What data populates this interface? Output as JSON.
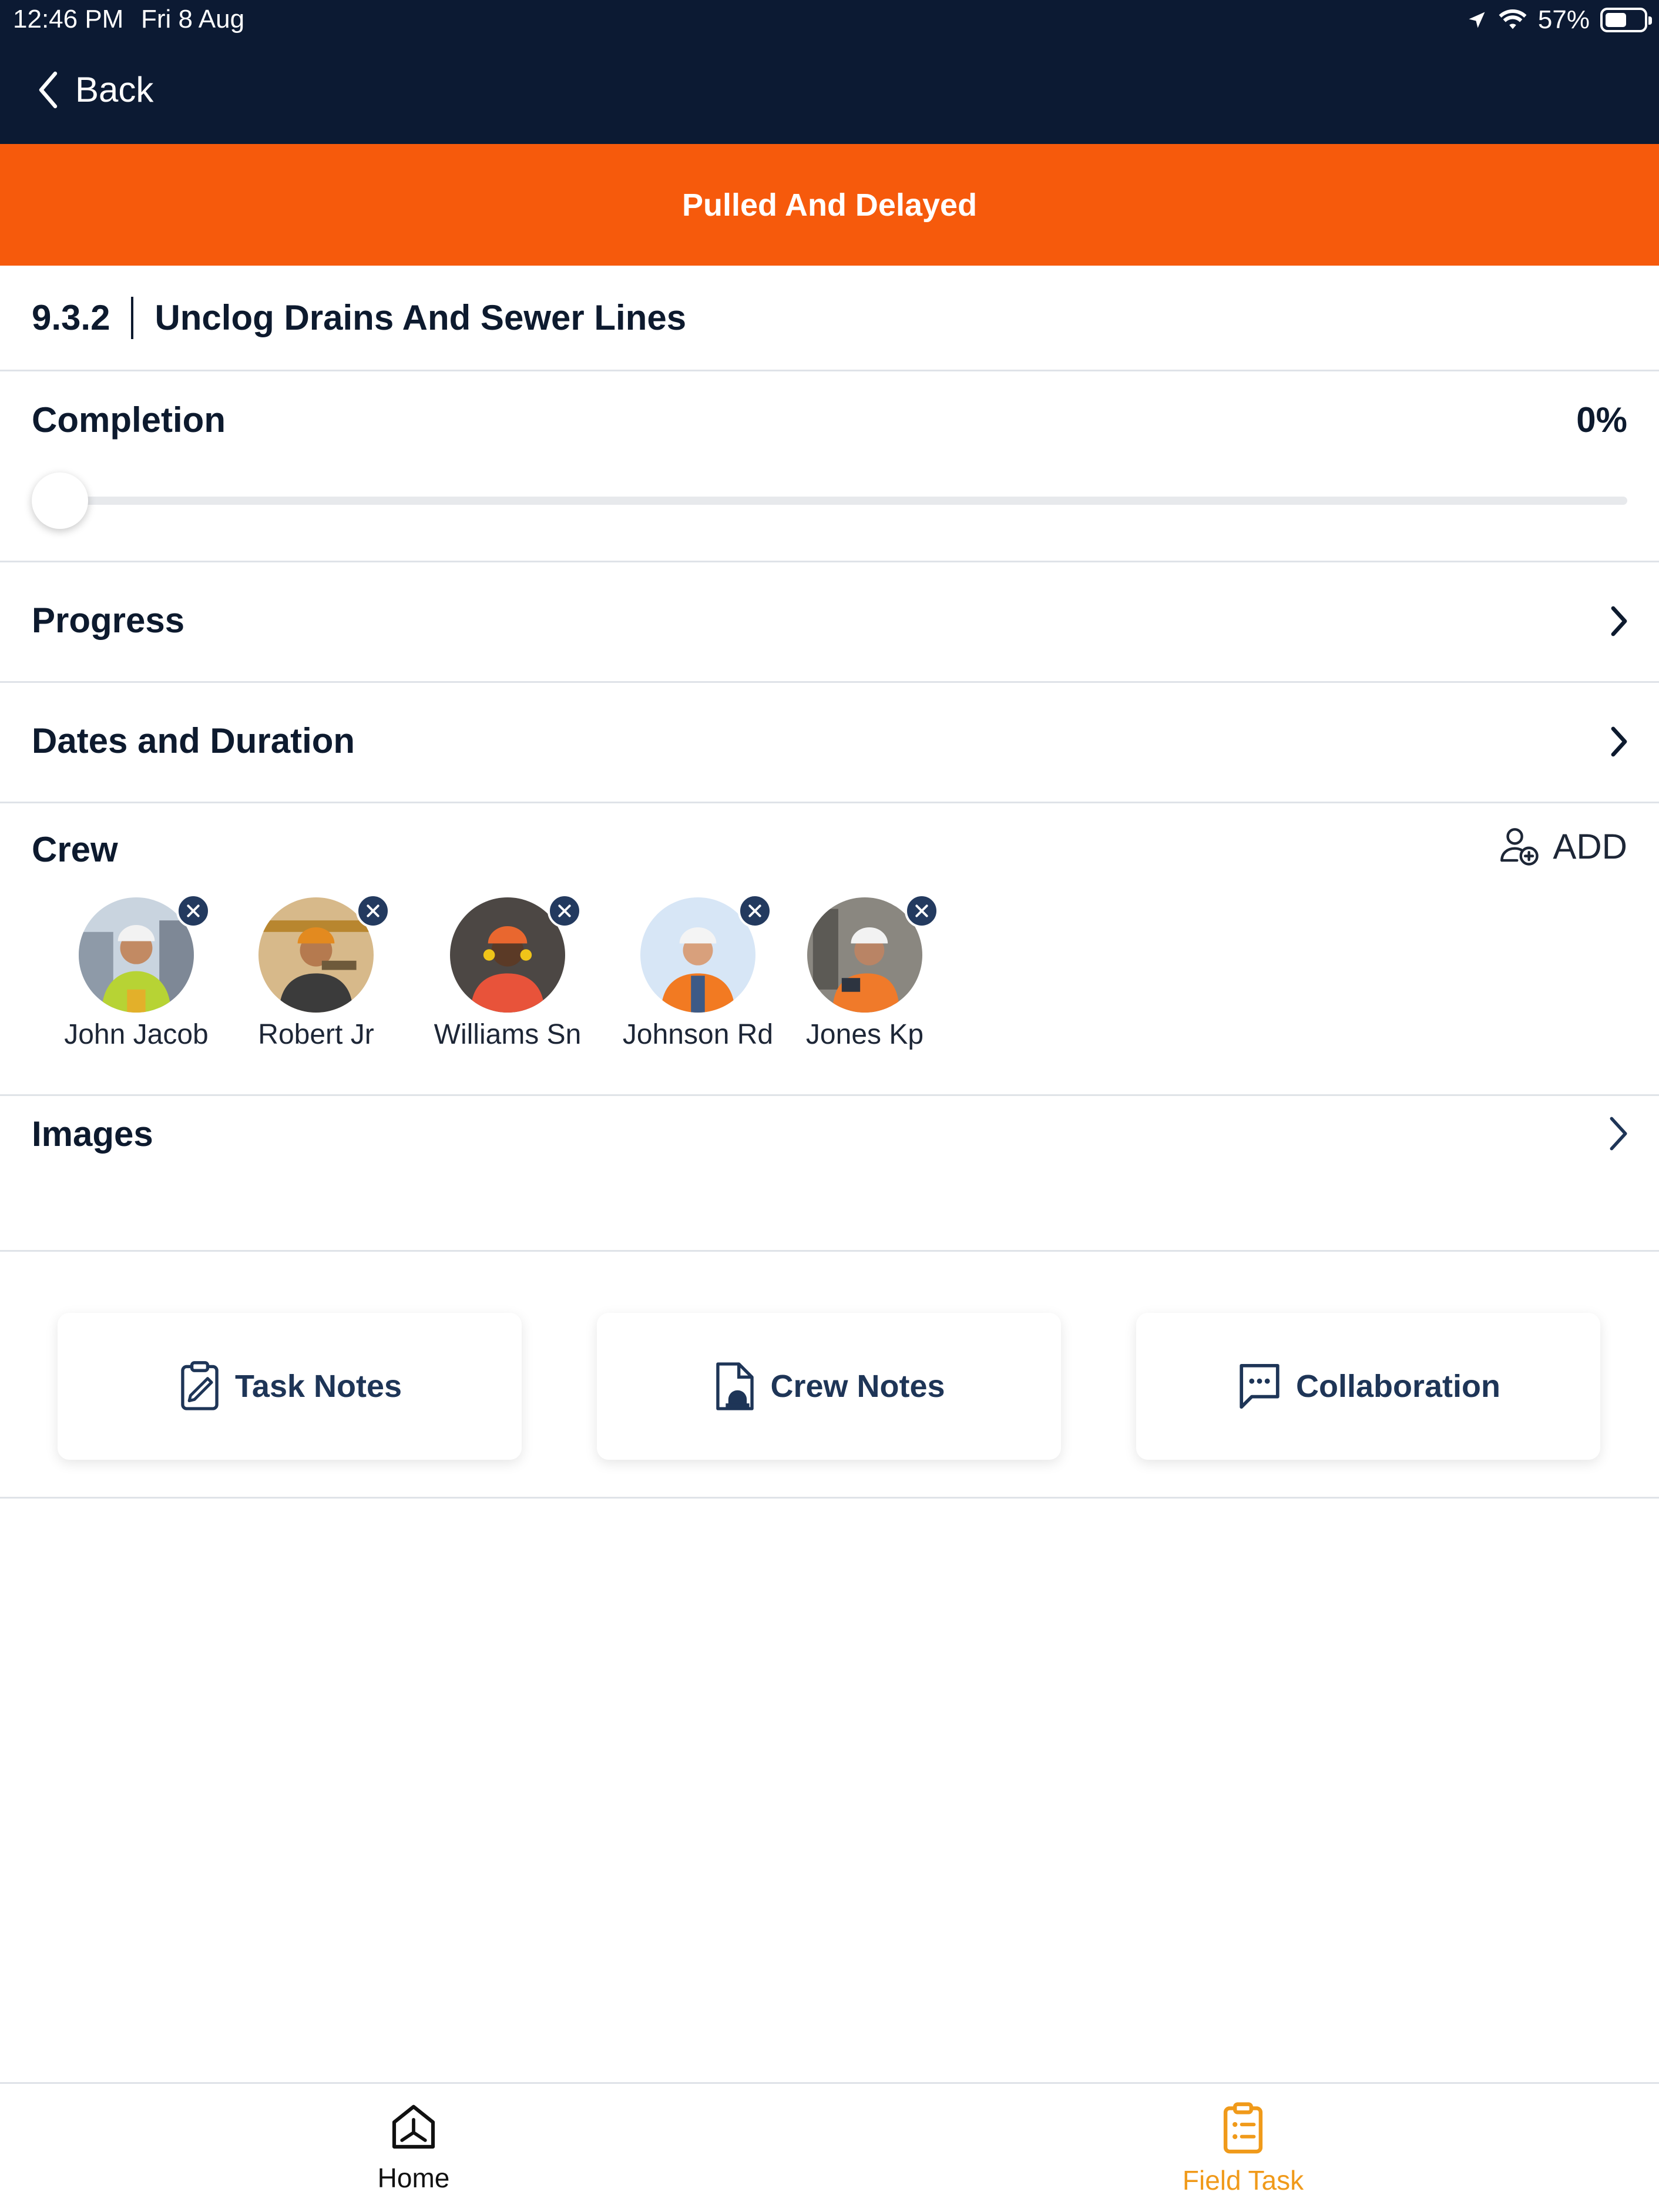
{
  "status_bar": {
    "time": "12:46 PM",
    "date": "Fri 8 Aug",
    "battery": "57%",
    "battery_level": 0.57
  },
  "nav": {
    "back_label": "Back"
  },
  "banner": {
    "text": "Pulled And Delayed",
    "color": "#f65a0c"
  },
  "task": {
    "number": "9.3.2",
    "title": "Unclog Drains And Sewer Lines"
  },
  "completion": {
    "title": "Completion",
    "percent_label": "0%",
    "value": 0
  },
  "sections": {
    "progress": "Progress",
    "dates": "Dates and Duration",
    "images": "Images"
  },
  "crew": {
    "title": "Crew",
    "add_label": "ADD",
    "members": [
      {
        "name": "John Jacob"
      },
      {
        "name": "Robert Jr"
      },
      {
        "name": "Williams Sn"
      },
      {
        "name": "Johnson Rd"
      },
      {
        "name": "Jones Kp"
      }
    ]
  },
  "actions": {
    "task_notes": "Task Notes",
    "crew_notes": "Crew Notes",
    "collaboration": "Collaboration"
  },
  "tabbar": {
    "home": "Home",
    "field_task": "Field Task",
    "active": "field_task",
    "active_color": "#f09a1a"
  },
  "colors": {
    "header": "#0c1a33",
    "accent": "#f65a0c",
    "text": "#0d1a2e"
  }
}
